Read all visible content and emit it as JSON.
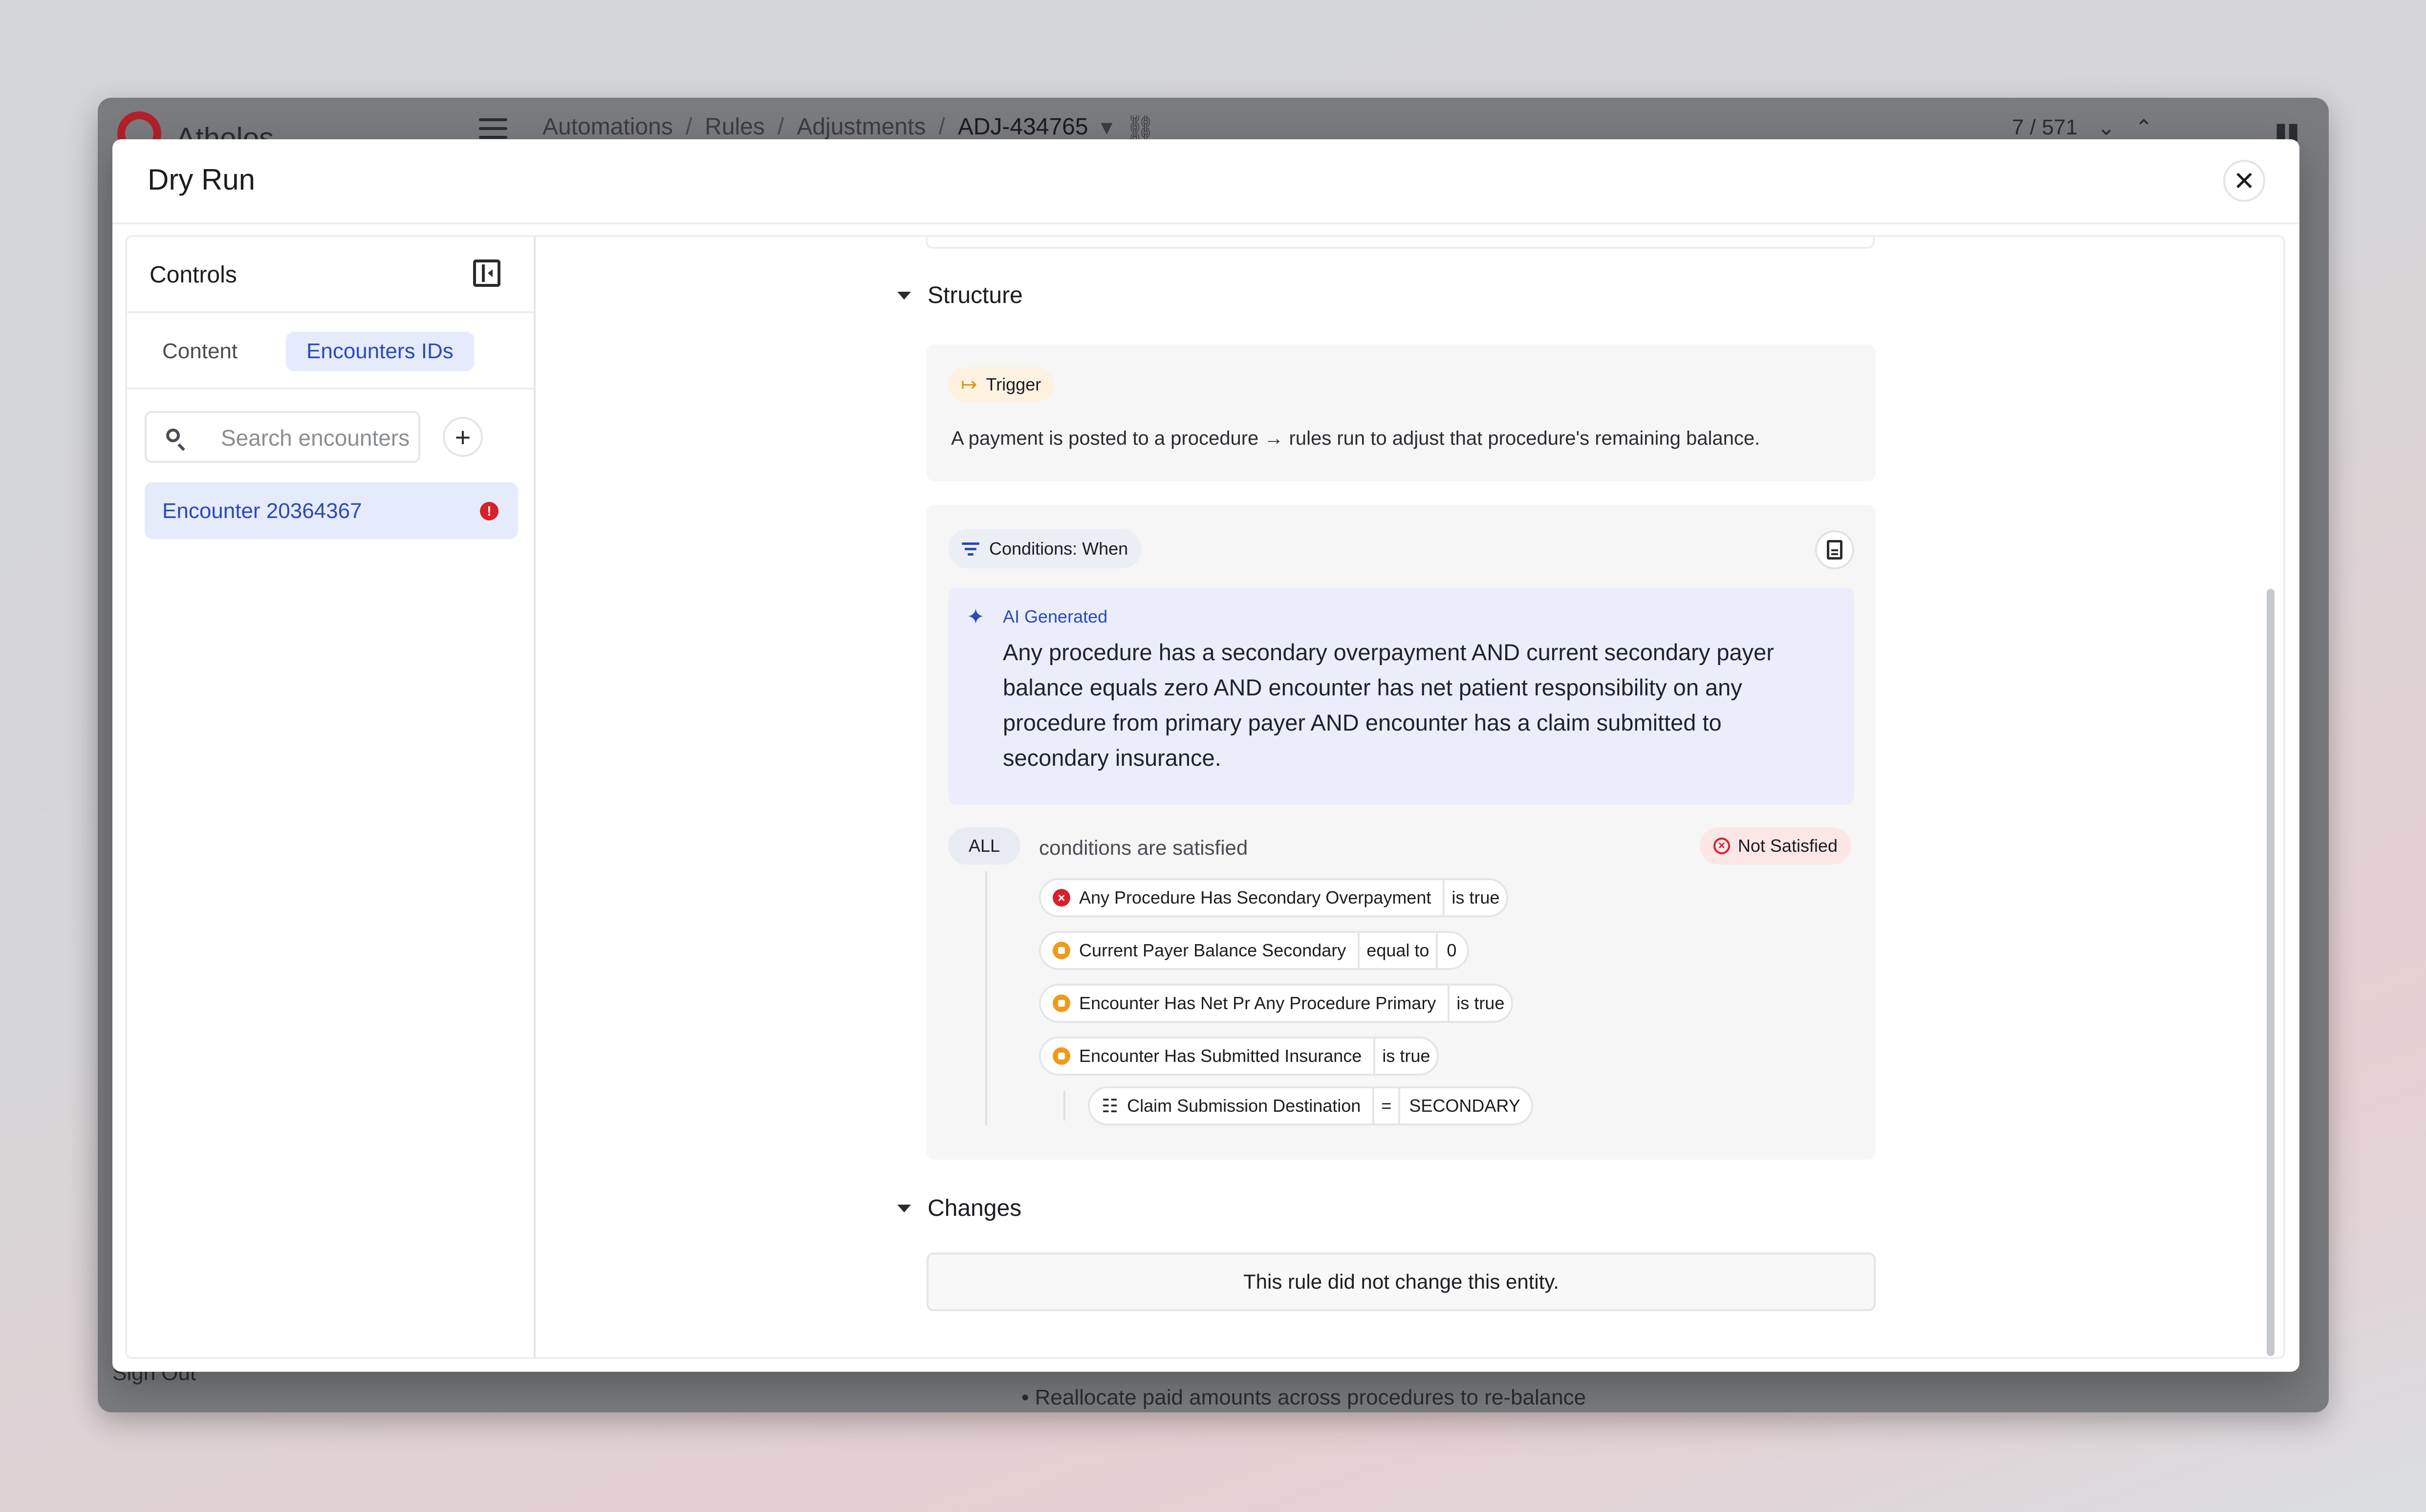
{
  "app": {
    "logo_text": "Atholos",
    "breadcrumbs": [
      "Automations",
      "Rules",
      "Adjustments",
      "ADJ-434765"
    ],
    "pager": "7 / 571",
    "signout": "Sign Out",
    "bg_bullet": "• Reallocate paid amounts across procedures to re-balance"
  },
  "modal": {
    "title": "Dry Run",
    "close_icon": "close-icon"
  },
  "sidebar": {
    "title": "Controls",
    "tabs": [
      {
        "label": "Content",
        "active": false
      },
      {
        "label": "Encounters IDs",
        "active": true
      }
    ],
    "search_placeholder": "Search encounters",
    "add_label": "+",
    "encounters": [
      {
        "label": "Encounter 20364367",
        "status": "error"
      }
    ]
  },
  "structure": {
    "heading": "Structure",
    "trigger": {
      "chip": "Trigger",
      "text": "A payment is posted to a procedure → rules run to adjust that procedure's remaining balance."
    },
    "conditions": {
      "chip": "Conditions: When",
      "ai_label": "AI Generated",
      "ai_text": "Any procedure has a secondary overpayment AND current secondary payer balance equals zero AND encounter has net patient responsibility on any procedure from primary payer AND encounter has a claim submitted to secondary insurance.",
      "quantifier": "ALL",
      "quantifier_text": "conditions are satisfied",
      "status": "Not Satisfied",
      "rows": [
        {
          "name": "Any Procedure Has Secondary Overpayment",
          "op": "is true",
          "val": "",
          "status": "fail"
        },
        {
          "name": "Current Payer Balance Secondary",
          "op": "equal to",
          "val": "0",
          "status": "pending"
        },
        {
          "name": "Encounter Has Net Pr Any Procedure Primary",
          "op": "is true",
          "val": "",
          "status": "pending"
        },
        {
          "name": "Encounter Has Submitted Insurance",
          "op": "is true",
          "val": "",
          "status": "pending"
        },
        {
          "name": "Claim Submission Destination",
          "op": "=",
          "val": "SECONDARY",
          "status": "param"
        }
      ]
    }
  },
  "changes": {
    "heading": "Changes",
    "message": "This rule did not change this entity."
  },
  "colors": {
    "accent": "#2a4ab8",
    "error": "#d7202b",
    "pending": "#f09a1a",
    "trigger": "#e39317"
  }
}
